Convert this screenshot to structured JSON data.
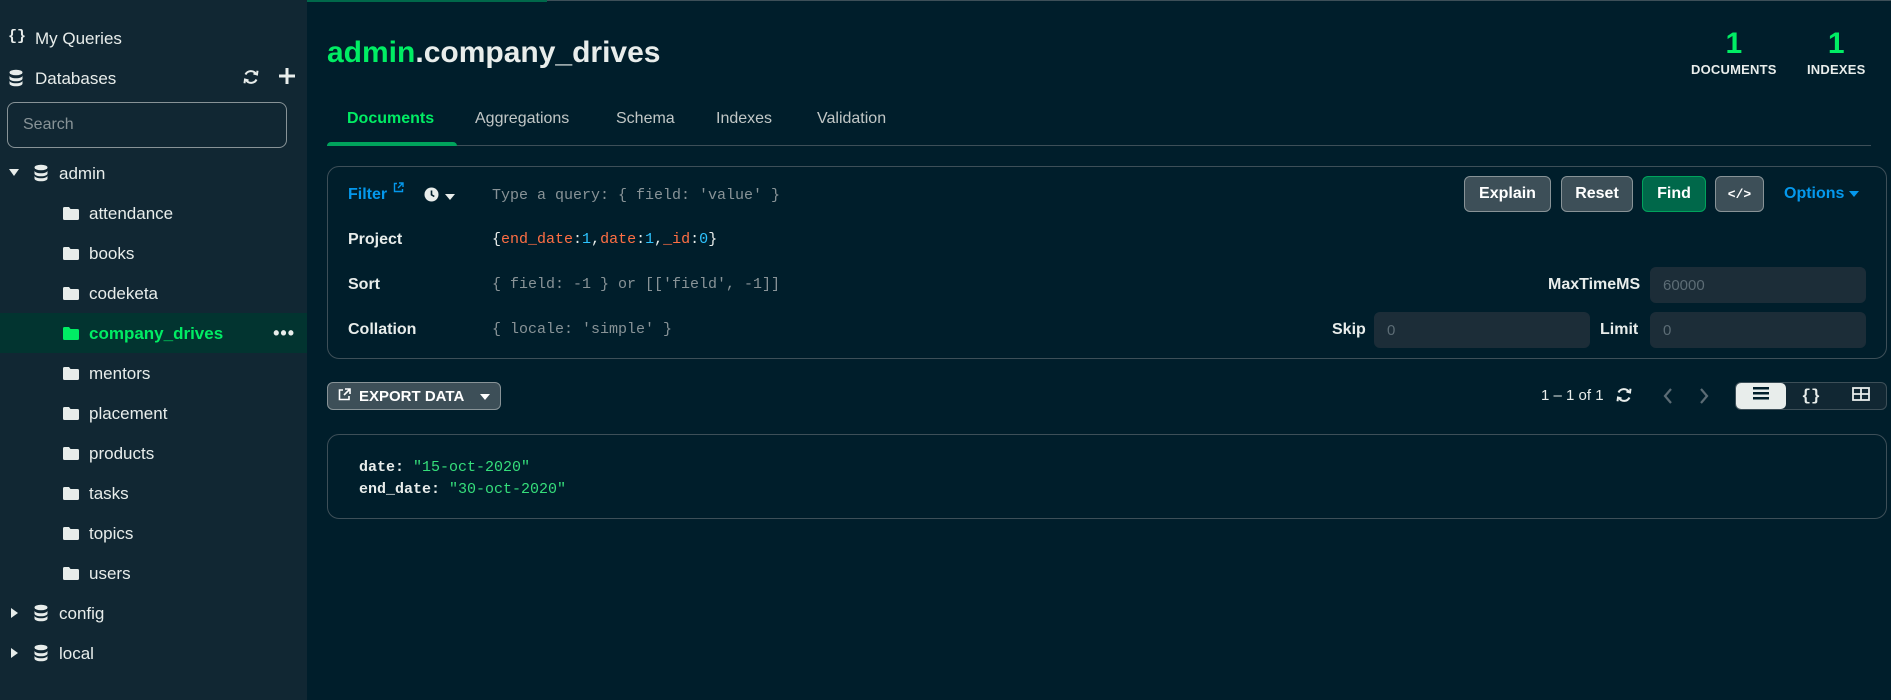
{
  "sidebar": {
    "my_queries": "My Queries",
    "databases": "Databases",
    "search_placeholder": "Search",
    "dbs": [
      {
        "name": "admin",
        "expanded": true
      },
      {
        "name": "config",
        "expanded": false
      },
      {
        "name": "local",
        "expanded": false
      }
    ],
    "collections": [
      "attendance",
      "books",
      "codeketa",
      "company_drives",
      "mentors",
      "placement",
      "products",
      "tasks",
      "topics",
      "users"
    ],
    "active_collection": "company_drives",
    "more_label": "•••"
  },
  "header": {
    "db": "admin",
    "collection": ".company_drives",
    "documents_count": "1",
    "documents_label": "DOCUMENTS",
    "indexes_count": "1",
    "indexes_label": "INDEXES"
  },
  "tabs": [
    "Documents",
    "Aggregations",
    "Schema",
    "Indexes",
    "Validation"
  ],
  "query": {
    "filter_label": "Filter",
    "filter_placeholder": "Type a query: { field: 'value' }",
    "project_label": "Project",
    "project_open": "{",
    "project_k1": "end_date",
    "project_v1": "1",
    "project_k2": "date",
    "project_v2": "1",
    "project_k3": "_id",
    "project_v3": "0",
    "project_close": "}",
    "sort_label": "Sort",
    "sort_placeholder": "{ field: -1 } or [['field', -1]]",
    "collation_label": "Collation",
    "collation_placeholder": "{ locale: 'simple' }",
    "explain": "Explain",
    "reset": "Reset",
    "find": "Find",
    "code_icon": "</>",
    "options": "Options",
    "maxtime_label": "MaxTimeMS",
    "maxtime_placeholder": "60000",
    "skip_label": "Skip",
    "skip_placeholder": "0",
    "limit_label": "Limit",
    "limit_placeholder": "0"
  },
  "results": {
    "export_label": "EXPORT DATA",
    "pager": "1 – 1 of 1"
  },
  "document": {
    "fields": [
      {
        "key": "date",
        "value": "\"15-oct-2020\""
      },
      {
        "key": "end_date",
        "value": "\"30-oct-2020\""
      }
    ]
  },
  "colors": {
    "accent": "#00ed64",
    "link": "#0498ec",
    "bg": "#001e2b",
    "sidebar": "#112733"
  }
}
